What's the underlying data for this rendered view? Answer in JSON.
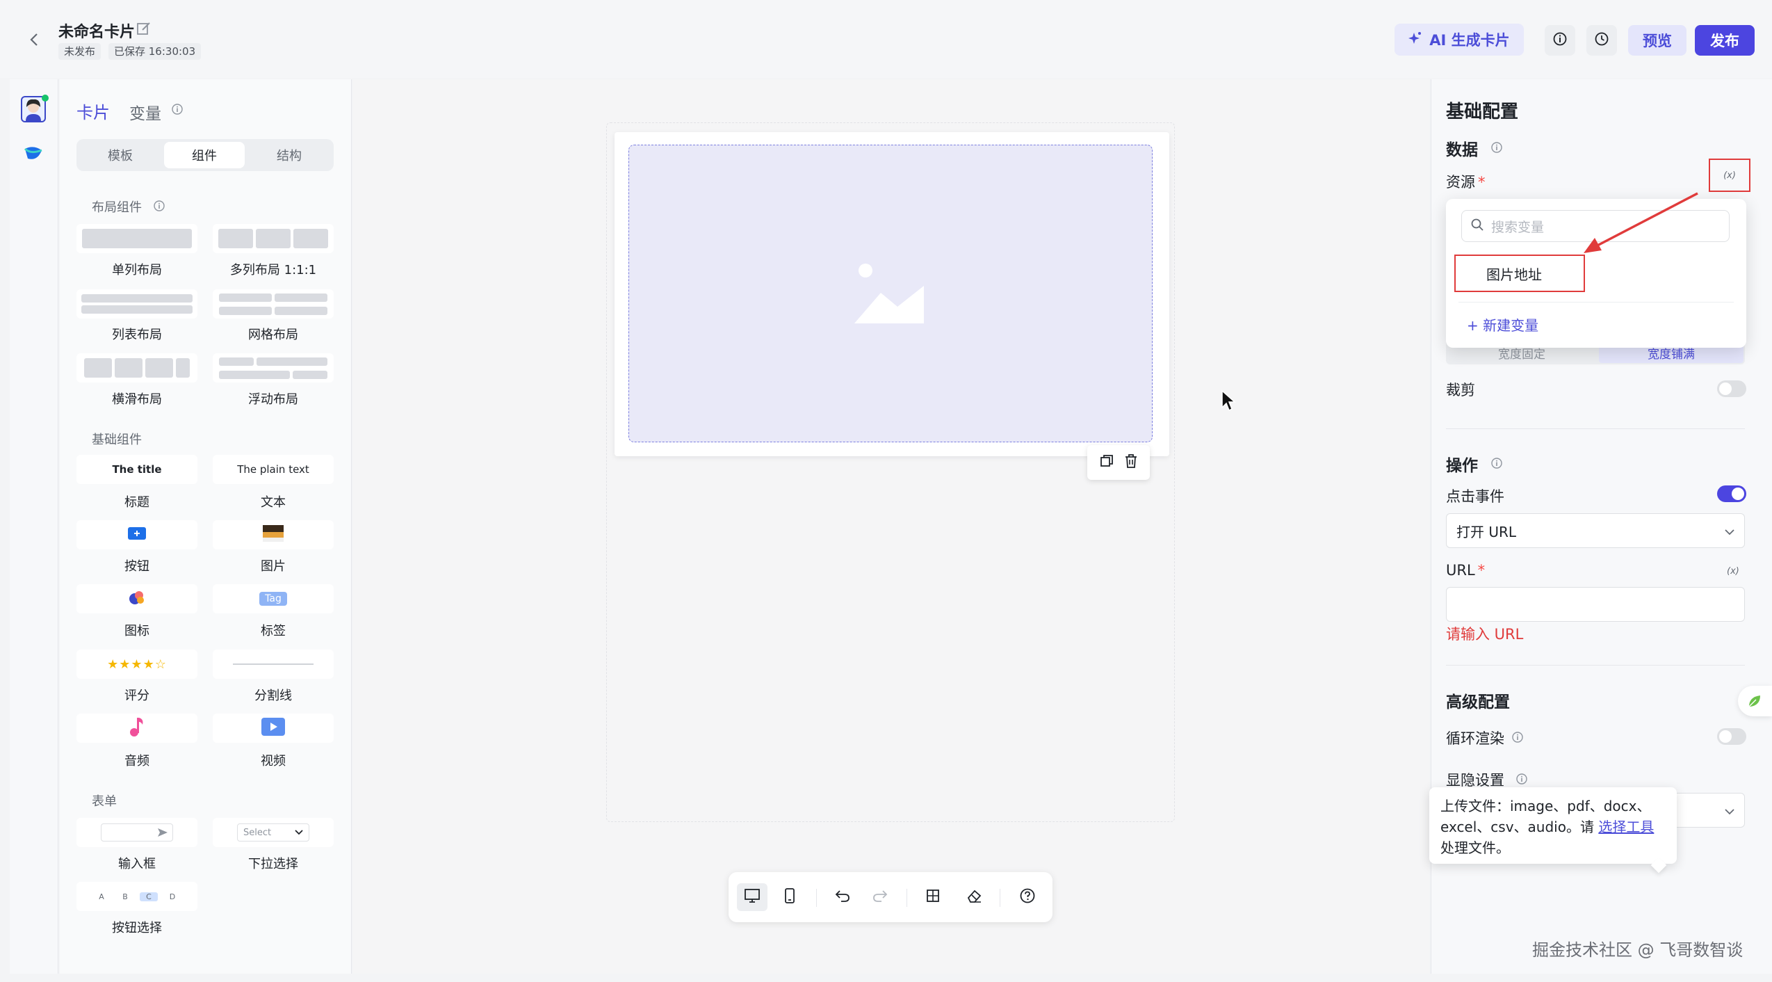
{
  "header": {
    "title": "未命名卡片",
    "status_tag": "未发布",
    "saved_tag": "已保存 16:30:03",
    "ai_button": "AI 生成卡片",
    "preview_button": "预览",
    "publish_button": "发布"
  },
  "left_panel": {
    "tab_card": "卡片",
    "tab_variable": "变量",
    "segments": [
      "模板",
      "组件",
      "结构"
    ],
    "layout_section": {
      "title": "布局组件",
      "items": [
        "单列布局",
        "多列布局 1:1:1",
        "列表布局",
        "网格布局",
        "横滑布局",
        "浮动布局"
      ]
    },
    "basic_section": {
      "title": "基础组件",
      "title_preview": "The title",
      "text_preview": "The plain text",
      "tag_preview": "Tag",
      "items": [
        "标题",
        "文本",
        "按钮",
        "图片",
        "图标",
        "标签",
        "评分",
        "分割线",
        "音频",
        "视频"
      ]
    },
    "form_section": {
      "title": "表单",
      "select_preview": "Select",
      "choice_preview": [
        "A",
        "B",
        "C",
        "D"
      ],
      "items": [
        "输入框",
        "下拉选择",
        "按钮选择"
      ]
    }
  },
  "config": {
    "title": "基础配置",
    "data_heading": "数据",
    "source_label": "资源",
    "var_symbol": "(x)",
    "width_options": [
      "宽度固定",
      "宽度铺满"
    ],
    "crop_label": "裁剪",
    "action_heading": "操作",
    "click_event_label": "点击事件",
    "click_action_value": "打开 URL",
    "url_label": "URL",
    "url_error": "请输入 URL",
    "advanced_heading": "高级配置",
    "loop_render_label": "循环渲染",
    "visibility_label": "显隐设置",
    "popup": {
      "search_placeholder": "搜索变量",
      "item": "图片地址",
      "new_variable": "+ 新建变量"
    }
  },
  "tooltip": {
    "line1": "上传文件：image、pdf、docx、",
    "line2_prefix": "excel、csv、audio。请 ",
    "link": "选择工具",
    "line3": "处理文件。"
  },
  "watermark": "掘金技术社区 @ 飞哥数智谈",
  "colors": {
    "accent": "#4c45e0",
    "accent_text": "#4c4dd8",
    "error": "#e03b3b",
    "placeholder_bg": "#e9e9f8"
  }
}
